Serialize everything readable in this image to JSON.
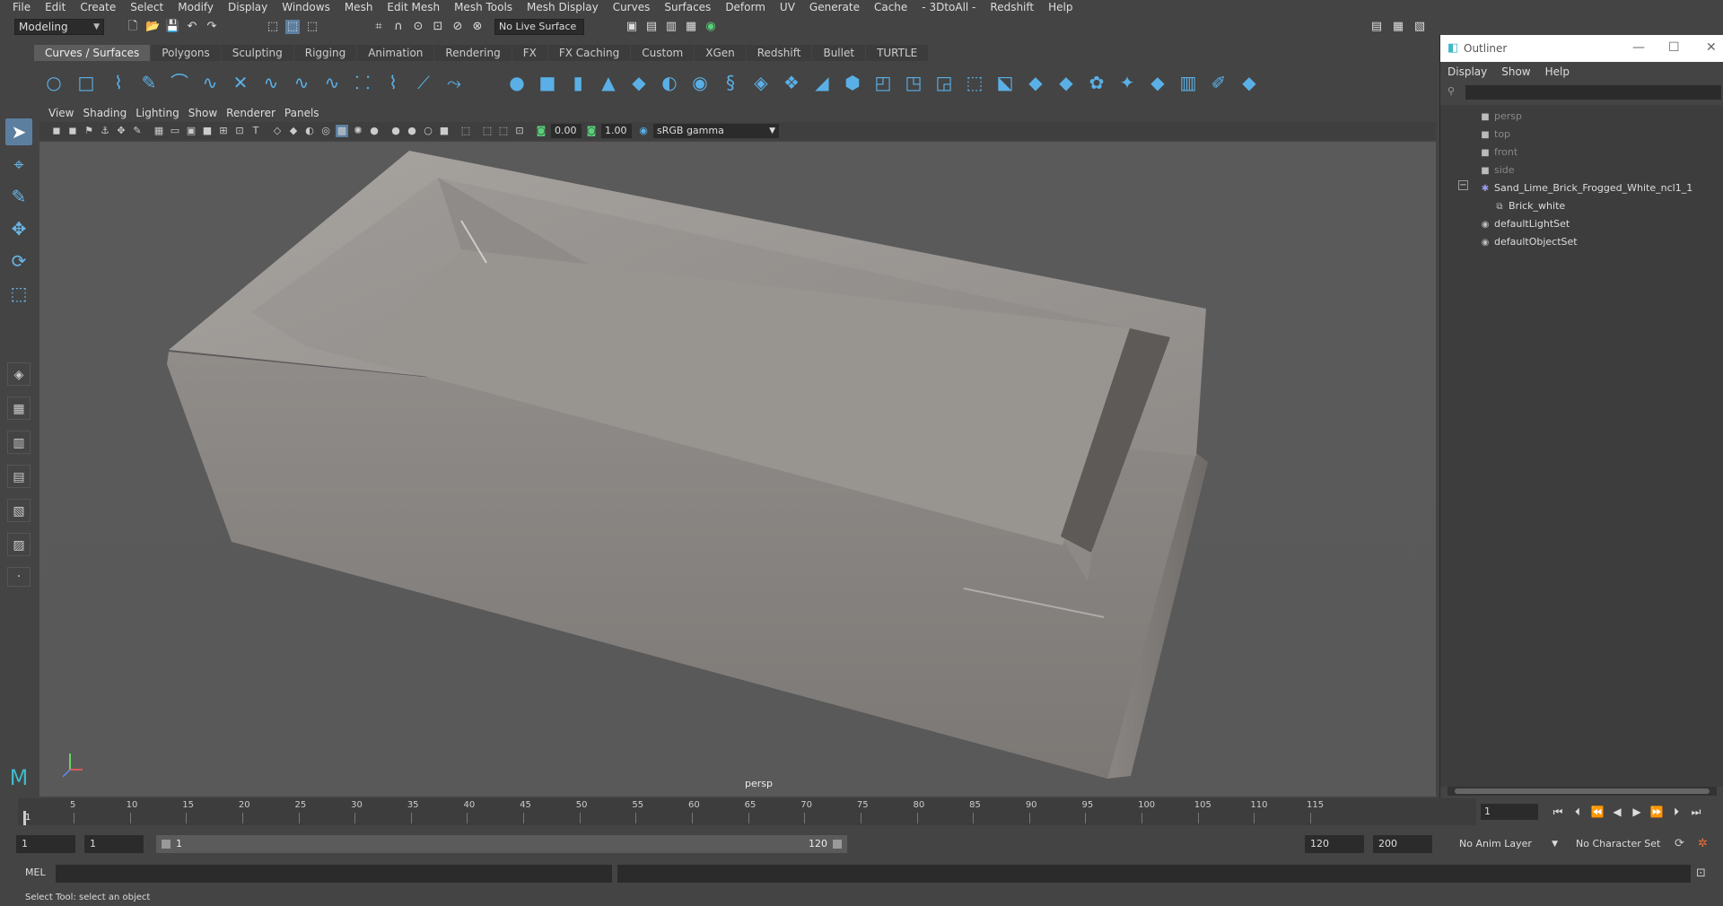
{
  "menubar": [
    "File",
    "Edit",
    "Create",
    "Select",
    "Modify",
    "Display",
    "Windows",
    "Mesh",
    "Edit Mesh",
    "Mesh Tools",
    "Mesh Display",
    "Curves",
    "Surfaces",
    "Deform",
    "UV",
    "Generate",
    "Cache",
    "- 3DtoAll -",
    "Redshift",
    "Help"
  ],
  "statusline": {
    "mode": "Modeling",
    "live_surface": "No Live Surface"
  },
  "shelf_tabs": [
    "Curves / Surfaces",
    "Polygons",
    "Sculpting",
    "Rigging",
    "Animation",
    "Rendering",
    "FX",
    "FX Caching",
    "Custom",
    "XGen",
    "Redshift",
    "Bullet",
    "TURTLE"
  ],
  "shelf_active": "Curves / Surfaces",
  "viewport": {
    "menu": [
      "View",
      "Shading",
      "Lighting",
      "Show",
      "Renderer",
      "Panels"
    ],
    "exposure": "0.00",
    "gamma_value": "1.00",
    "color_space": "sRGB gamma",
    "camera": "persp"
  },
  "outliner": {
    "title": "Outliner",
    "menu": [
      "Display",
      "Show",
      "Help"
    ],
    "items": [
      {
        "label": "persp",
        "icon": "camera-icon"
      },
      {
        "label": "top",
        "icon": "camera-icon"
      },
      {
        "label": "front",
        "icon": "camera-icon"
      },
      {
        "label": "side",
        "icon": "camera-icon"
      },
      {
        "label": "Sand_Lime_Brick_Frogged_White_ncl1_1",
        "icon": "group-icon"
      },
      {
        "label": "Brick_white",
        "icon": "mesh-icon"
      },
      {
        "label": "defaultLightSet",
        "icon": "set-icon"
      },
      {
        "label": "defaultObjectSet",
        "icon": "set-icon"
      }
    ]
  },
  "timeline": {
    "ticks": [
      "5",
      "10",
      "15",
      "20",
      "25",
      "30",
      "35",
      "40",
      "45",
      "50",
      "55",
      "60",
      "65",
      "70",
      "75",
      "80",
      "85",
      "90",
      "95",
      "100",
      "105",
      "110",
      "115"
    ],
    "current_frame": "1",
    "current_frame_field": "1"
  },
  "range": {
    "start": "1",
    "playback_start": "1",
    "range_start": "1",
    "range_end": "120",
    "playback_end": "120",
    "end": "200",
    "anim_layer": "No Anim Layer",
    "character_set": "No Character Set"
  },
  "command": {
    "label": "MEL"
  },
  "help": "Select Tool: select an object",
  "colors": {
    "accent": "#5ab0e6",
    "viewport_bg": "#5a5a5a",
    "panel_bg": "#444444"
  }
}
